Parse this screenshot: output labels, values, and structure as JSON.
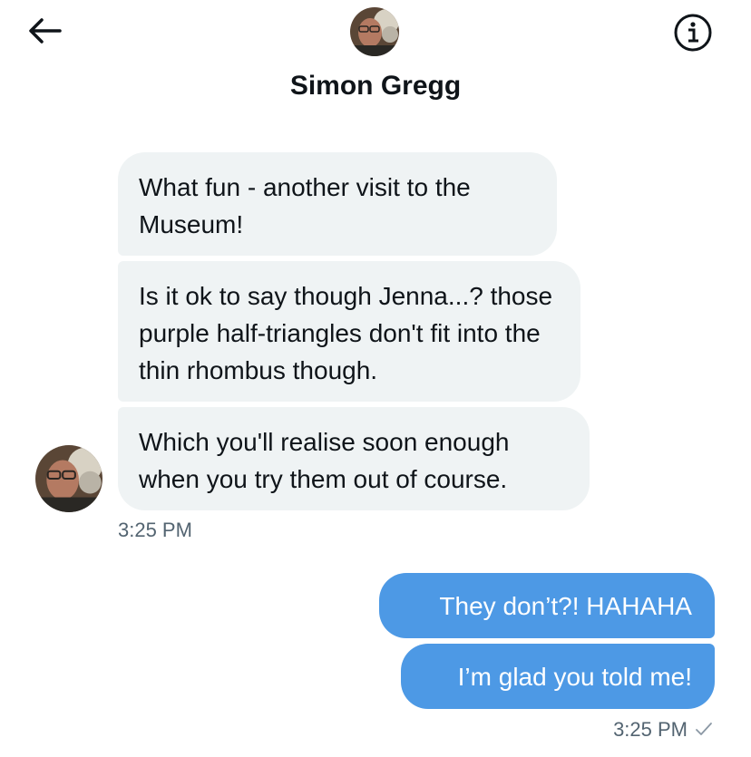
{
  "header": {
    "contact_name": "Simon Gregg",
    "back_icon": "arrow-left-icon",
    "info_icon": "info-circle-icon"
  },
  "conversation": {
    "incoming": [
      {
        "text": "What fun - another visit to the Museum!"
      },
      {
        "text": "Is it ok to say though Jenna...? those purple half-triangles don't fit into the thin rhombus though."
      },
      {
        "text": "Which you'll realise soon enough when you try them out of course."
      }
    ],
    "incoming_time": "3:25 PM",
    "outgoing": [
      {
        "text": "They don’t?! HAHAHA"
      },
      {
        "text": "I’m glad you told me!"
      }
    ],
    "outgoing_time": "3:25 PM",
    "outgoing_status_icon": "checkmark-icon"
  },
  "colors": {
    "incoming_bubble": "#eff3f4",
    "outgoing_bubble": "#4d99e5",
    "timestamp": "#536471"
  }
}
